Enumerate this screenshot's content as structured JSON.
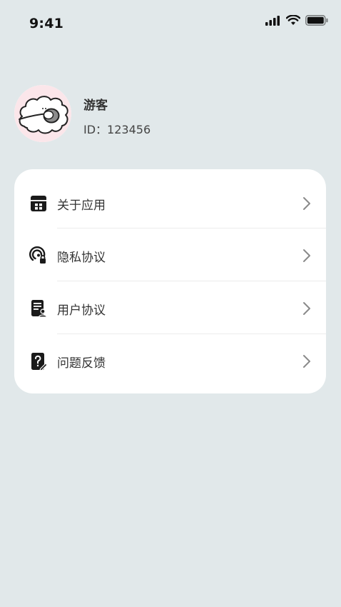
{
  "status_bar": {
    "time": "9:41"
  },
  "profile": {
    "name": "游客",
    "id_text": "ID：123456"
  },
  "menu": {
    "items": [
      {
        "label": "关于应用",
        "icon": "app-info-icon"
      },
      {
        "label": "隐私协议",
        "icon": "privacy-lock-icon"
      },
      {
        "label": "用户协议",
        "icon": "user-agreement-icon"
      },
      {
        "label": "问题反馈",
        "icon": "feedback-question-icon"
      }
    ]
  },
  "colors": {
    "background": "#e1e8ea",
    "card": "#ffffff",
    "icon": "#1a1a1a",
    "chevron": "#8a8a8a",
    "avatar_bg": "#fbe6ea"
  }
}
